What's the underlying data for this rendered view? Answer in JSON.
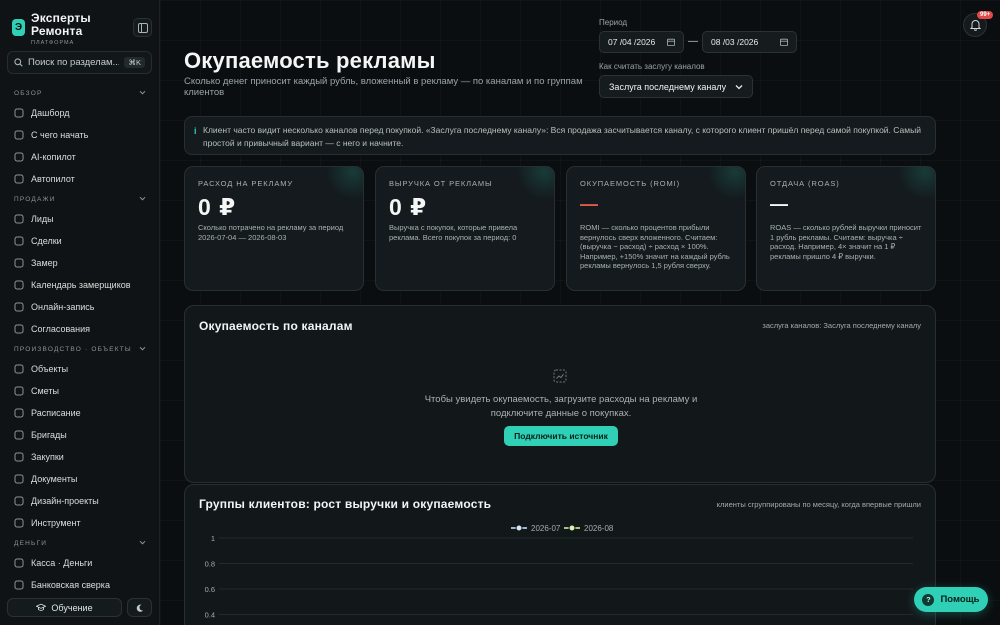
{
  "brand": {
    "title_line1": "Эксперты",
    "title_line2": "Ремонта",
    "subtitle": "ПЛАТФОРМА",
    "logo_letter": "Э"
  },
  "search": {
    "placeholder": "Поиск по разделам...",
    "shortcut": "⌘K"
  },
  "sidebar": {
    "sections": [
      {
        "title": "ОБЗОР",
        "items": [
          {
            "label": "Дашборд",
            "icon": "dashboard-icon"
          },
          {
            "label": "С чего начать",
            "icon": "compass-icon"
          },
          {
            "label": "AI-копилот",
            "icon": "sparkle-icon"
          },
          {
            "label": "Автопилот",
            "icon": "bolt-icon"
          }
        ]
      },
      {
        "title": "ПРОДАЖИ",
        "items": [
          {
            "label": "Лиды",
            "icon": "users-icon"
          },
          {
            "label": "Сделки",
            "icon": "handshake-icon"
          },
          {
            "label": "Замер",
            "icon": "ruler-icon"
          },
          {
            "label": "Календарь замерщиков",
            "icon": "calendar-icon"
          },
          {
            "label": "Онлайн-запись",
            "icon": "clock-icon"
          },
          {
            "label": "Согласования",
            "icon": "check-icon"
          }
        ]
      },
      {
        "title": "ПРОИЗВОДСТВО · ОБЪЕКТЫ",
        "items": [
          {
            "label": "Объекты",
            "icon": "building-icon"
          },
          {
            "label": "Сметы",
            "icon": "calculator-icon"
          },
          {
            "label": "Расписание",
            "icon": "schedule-icon"
          },
          {
            "label": "Бригады",
            "icon": "team-icon"
          },
          {
            "label": "Закупки",
            "icon": "cart-icon"
          },
          {
            "label": "Документы",
            "icon": "document-icon"
          },
          {
            "label": "Дизайн-проекты",
            "icon": "palette-icon"
          },
          {
            "label": "Инструмент",
            "icon": "wrench-icon"
          }
        ]
      },
      {
        "title": "ДЕНЬГИ",
        "items": [
          {
            "label": "Касса · Деньги",
            "icon": "wallet-icon"
          },
          {
            "label": "Банковская сверка",
            "icon": "bank-icon"
          }
        ]
      }
    ],
    "learn_label": "Обучение",
    "theme_icon": "moon-icon"
  },
  "header": {
    "title": "Окупаемость рекламы",
    "subtitle": "Сколько денег приносит каждый рубль, вложенный в рекламу — по каналам и по группам клиентов",
    "period_label": "Период",
    "date_from": "07 /04 /2026",
    "date_to": "08 /03 /2026",
    "date_separator": "—",
    "attribution_label": "Как считать заслугу каналов",
    "attribution_value": "Заслуга последнему каналу",
    "notifications_badge": "99+"
  },
  "info": {
    "mark": "i",
    "text": "Клиент часто видит несколько каналов перед покупкой. «Заслуга последнему каналу»: Вся продажа засчитывается каналу, с которого клиент пришёл перед самой покупкой. Самый простой и привычный вариант — с него и начните."
  },
  "kpis": [
    {
      "label": "РАСХОД НА РЕКЛАМУ",
      "value": "0 ₽",
      "desc": "Сколько потрачено на рекламу за период 2026-07-04 — 2026-08-03"
    },
    {
      "label": "ВЫРУЧКА ОТ РЕКЛАМЫ",
      "value": "0 ₽",
      "desc": "Выручка с покупок, которые привела реклама. Всего покупок за период: 0"
    },
    {
      "label": "ОКУПАЕМОСТЬ (ROMI)",
      "value": "—",
      "desc": "ROMI — сколько процентов прибыли вернулось сверх вложенного. Считаем: (выручка − расход) ÷ расход × 100%. Например, +150% значит на каждый рубль рекламы вернулось 1,5 рубля сверху."
    },
    {
      "label": "ОТДАЧА (ROAS)",
      "value": "—",
      "desc": "ROAS — сколько рублей выручки приносит 1 рубль рекламы. Считаем: выручка ÷ расход. Например, 4× значит на 1 ₽ рекламы пришло 4 ₽ выручки."
    }
  ],
  "channels_panel": {
    "title": "Окупаемость по каналам",
    "meta": "заслуга каналов: Заслуга последнему каналу",
    "empty_text": "Чтобы увидеть окупаемость, загрузите расходы на рекламу и подключите данные о покупках.",
    "cta": "Подключить источник"
  },
  "cohort_panel": {
    "title": "Группы клиентов: рост выручки и окупаемость",
    "meta": "клиенты сгруппированы по месяцу, когда впервые пришли"
  },
  "chart_data": {
    "type": "line",
    "series": [
      {
        "name": "2026-07",
        "values": [],
        "color": "#cfe9ff"
      },
      {
        "name": "2026-08",
        "values": [],
        "color": "#d8f5a8"
      }
    ],
    "yticks": [
      "1",
      "0.8",
      "0.6",
      "0.4"
    ],
    "ylim": [
      0,
      1
    ],
    "legend": "top-center",
    "grid": true
  },
  "help": {
    "label": "Помощь",
    "mark": "?"
  },
  "colors": {
    "accent": "#2fd0b5",
    "danger": "#e0594a",
    "background": "#0b0e10"
  }
}
